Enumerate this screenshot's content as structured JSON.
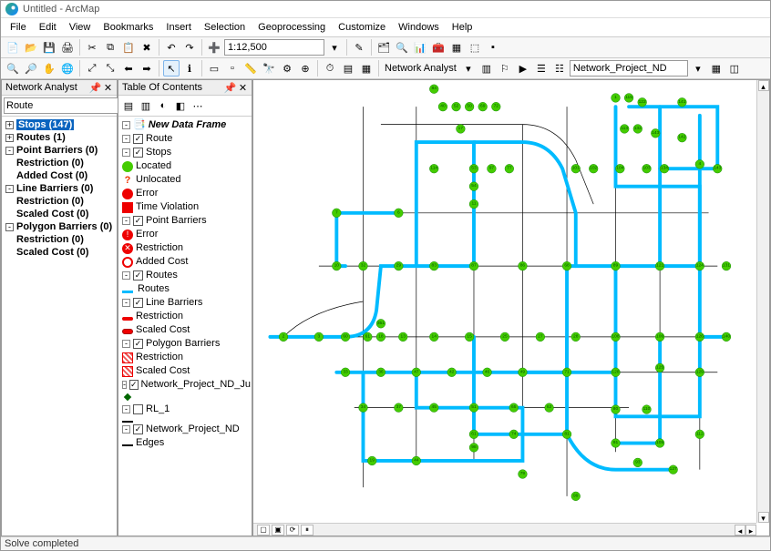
{
  "titlebar": {
    "title": "Untitled - ArcMap"
  },
  "menus": [
    "File",
    "Edit",
    "View",
    "Bookmarks",
    "Insert",
    "Selection",
    "Geoprocessing",
    "Customize",
    "Windows",
    "Help"
  ],
  "toolbar1": {
    "scale": "1:12,500"
  },
  "toolbar2": {
    "na_label": "Network Analyst",
    "na_dataset": "Network_Project_ND"
  },
  "na_panel": {
    "title": "Network Analyst",
    "combo": "Route",
    "items": [
      {
        "label": "Stops (147)",
        "sel": true
      },
      {
        "label": "Routes (1)"
      },
      {
        "label": "Point Barriers (0)",
        "expandable": true,
        "children": [
          {
            "label": "Restriction (0)"
          },
          {
            "label": "Added Cost (0)"
          }
        ]
      },
      {
        "label": "Line Barriers (0)",
        "expandable": true,
        "children": [
          {
            "label": "Restriction (0)"
          },
          {
            "label": "Scaled Cost (0)"
          }
        ]
      },
      {
        "label": "Polygon Barriers (0)",
        "expandable": true,
        "children": [
          {
            "label": "Restriction (0)"
          },
          {
            "label": "Scaled Cost (0)"
          }
        ]
      }
    ]
  },
  "toc": {
    "title": "Table Of Contents",
    "dataframe": "New Data Frame",
    "layers": {
      "route": "Route",
      "stops": "Stops",
      "located": "Located",
      "unlocated": "Unlocated",
      "error": "Error",
      "timev": "Time Violation",
      "pbarriers": "Point Barriers",
      "perror": "Error",
      "prestr": "Restriction",
      "padded": "Added Cost",
      "routes": "Routes",
      "routes_sym": "Routes",
      "lbarriers": "Line Barriers",
      "lrestr": "Restriction",
      "lscaled": "Scaled Cost",
      "polyb": "Polygon Barriers",
      "polyr": "Restriction",
      "polys": "Scaled Cost",
      "ndju": "Network_Project_ND_Ju",
      "rl1": "RL_1",
      "nd": "Network_Project_ND",
      "edges": "Edges"
    }
  },
  "status": {
    "text": "Solve completed"
  }
}
